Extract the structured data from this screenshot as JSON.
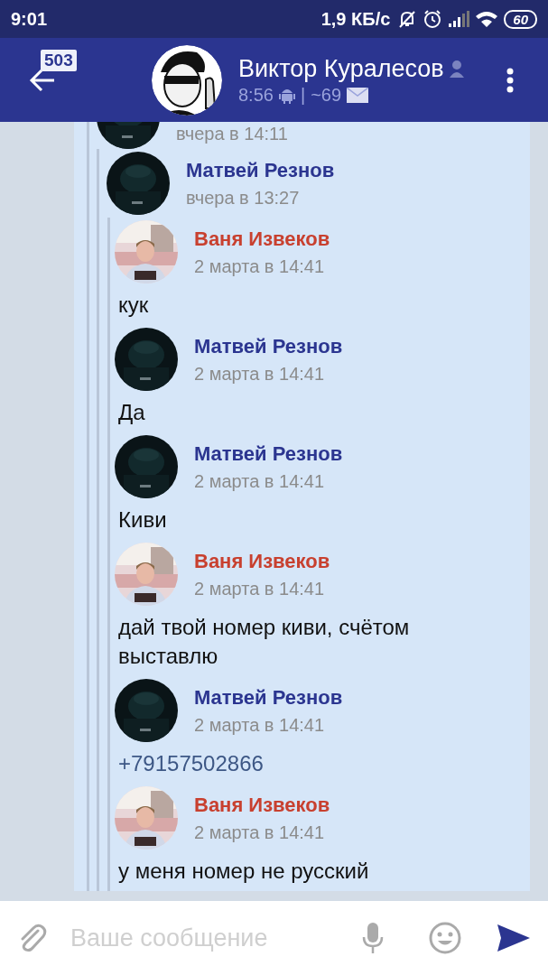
{
  "status_bar": {
    "time": "9:01",
    "speed": "1,9 КБ/с",
    "battery": "60"
  },
  "header": {
    "badge": "503",
    "title": "Виктор Куралесов",
    "last_seen": "8:56",
    "separator": "|",
    "count": "~69"
  },
  "thread": {
    "time": "вчера в 14:11",
    "forward": {
      "author": "Матвей Резнов",
      "color": "#2b3590",
      "time": "вчера в 13:27",
      "messages": [
        {
          "author": "Ваня Извеков",
          "color": "#c8402f",
          "time": "2 марта в 14:41",
          "kind": "text",
          "text": "кук"
        },
        {
          "author": "Матвей Резнов",
          "color": "#2b3590",
          "time": "2 марта в 14:41",
          "kind": "text",
          "text": "Да"
        },
        {
          "author": "Матвей Резнов",
          "color": "#2b3590",
          "time": "2 марта в 14:41",
          "kind": "text",
          "text": "Киви"
        },
        {
          "author": "Ваня Извеков",
          "color": "#c8402f",
          "time": "2 марта в 14:41",
          "kind": "text",
          "text": "дай твой номер киви, счётом выставлю"
        },
        {
          "author": "Матвей Резнов",
          "color": "#2b3590",
          "time": "2 марта в 14:41",
          "kind": "phone",
          "text": "+79157502866"
        },
        {
          "author": "Ваня Извеков",
          "color": "#c8402f",
          "time": "2 марта в 14:41",
          "kind": "text",
          "text": "у меня номер не русский"
        }
      ]
    }
  },
  "composer": {
    "placeholder": "Ваше сообщение"
  }
}
